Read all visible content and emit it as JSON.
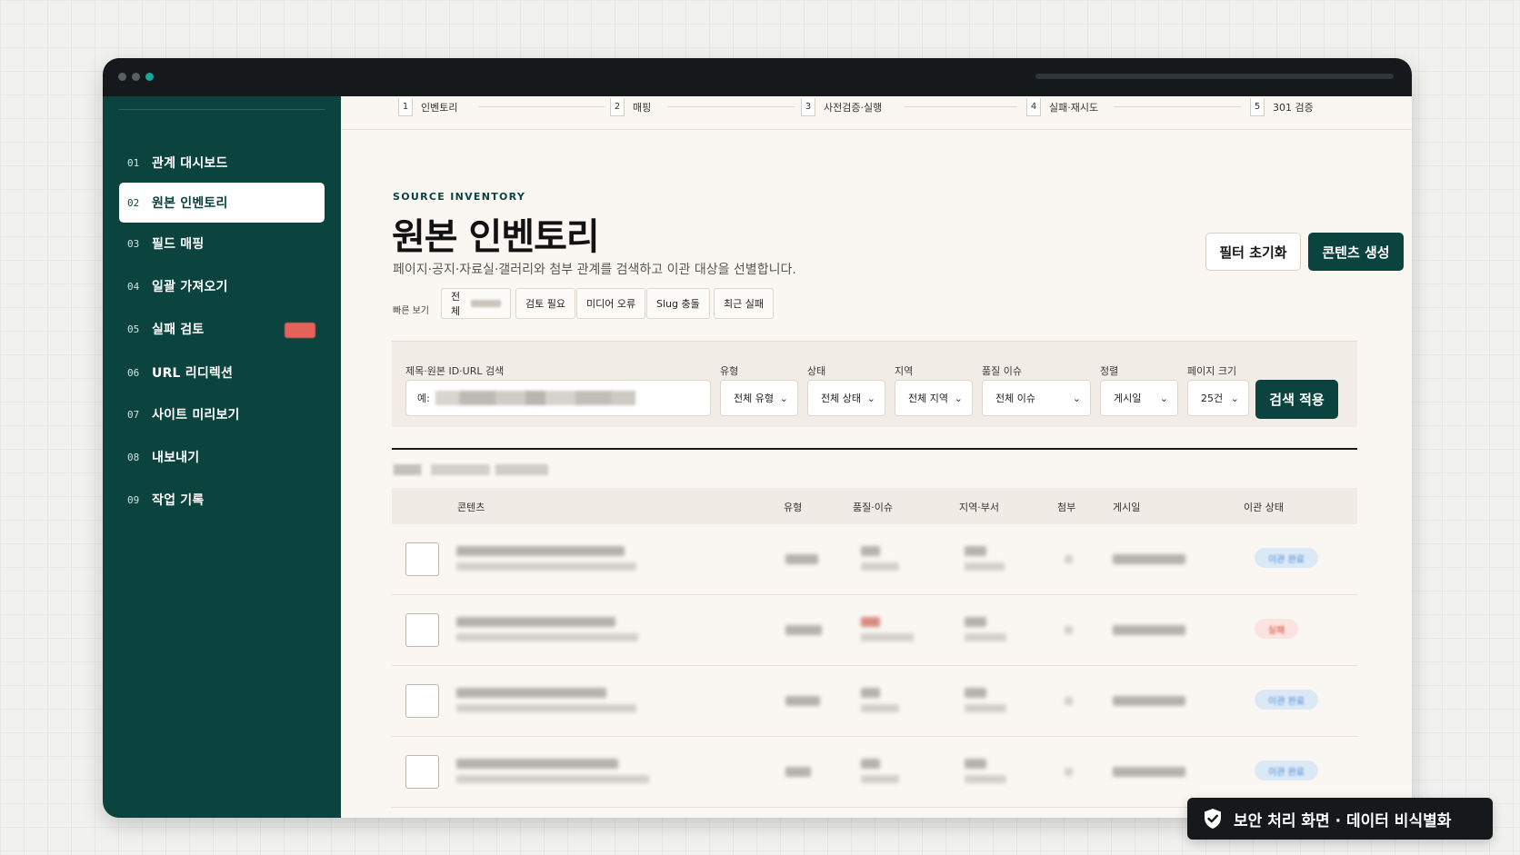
{
  "sidebar": {
    "items": [
      {
        "num": "01",
        "label": "관계 대시보드"
      },
      {
        "num": "02",
        "label": "원본 인벤토리"
      },
      {
        "num": "03",
        "label": "필드 매핑"
      },
      {
        "num": "04",
        "label": "일괄 가져오기"
      },
      {
        "num": "05",
        "label": "실패 검토"
      },
      {
        "num": "06",
        "label": "URL 리디렉션"
      },
      {
        "num": "07",
        "label": "사이트 미리보기"
      },
      {
        "num": "08",
        "label": "내보내기"
      },
      {
        "num": "09",
        "label": "작업 기록"
      }
    ],
    "active_index": 1
  },
  "stepper": {
    "steps": [
      {
        "num": "1",
        "label": "인벤토리"
      },
      {
        "num": "2",
        "label": "매핑"
      },
      {
        "num": "3",
        "label": "사전검증·실행"
      },
      {
        "num": "4",
        "label": "실패·재시도"
      },
      {
        "num": "5",
        "label": "301 검증"
      }
    ]
  },
  "header": {
    "eyebrow": "SOURCE INVENTORY",
    "title": "원본 인벤토리",
    "description": "페이지·공지·자료실·갤러리와 첨부 관계를 검색하고 이관 대상을 선별합니다.",
    "reset_label": "필터 초기화",
    "create_label": "콘텐츠 생성"
  },
  "quick_view": {
    "label": "빠른 보기",
    "chips": [
      "전체",
      "검토 필요",
      "미디어 오류",
      "Slug 충돌",
      "최근 실패"
    ]
  },
  "filters": {
    "search_label": "제목·원본 ID·URL 검색",
    "search_prefix": "예:",
    "type_label": "유형",
    "type_value": "전체 유형",
    "status_label": "상태",
    "status_value": "전체 상태",
    "region_label": "지역",
    "region_value": "전체 지역",
    "issue_label": "품질 이슈",
    "issue_value": "전체 이슈",
    "sort_label": "정렬",
    "sort_value": "게시일",
    "pagesize_label": "페이지 크기",
    "pagesize_value": "25건",
    "apply_label": "검색 적용"
  },
  "table": {
    "headers": {
      "content": "콘텐츠",
      "type": "유형",
      "quality": "품질·이슈",
      "region": "지역·부서",
      "attach": "첨부",
      "date": "게시일",
      "status": "이관 상태"
    },
    "rows": [
      {
        "status": "이관 완료",
        "status_color": "blue"
      },
      {
        "status": "실패",
        "status_color": "red"
      },
      {
        "status": "이관 완료",
        "status_color": "blue"
      },
      {
        "status": "이관 완료",
        "status_color": "blue"
      }
    ]
  },
  "notice": {
    "icon": "shield-check-icon",
    "text": "보안 처리 화면 · 데이터 비식별화"
  },
  "colors": {
    "sidebar": "#0b433f",
    "primary": "#0b433f",
    "titlebar": "#15191c",
    "status_blue": "#4c8ad0",
    "status_red": "#d9473a"
  }
}
